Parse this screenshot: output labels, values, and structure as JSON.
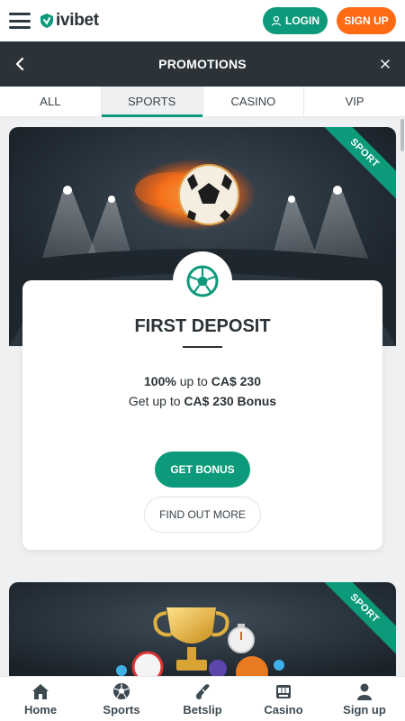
{
  "header": {
    "logo_text": "ivibet",
    "login_label": "LOGIN",
    "signup_label": "SIGN UP"
  },
  "promotions": {
    "title": "PROMOTIONS"
  },
  "tabs": [
    {
      "label": "ALL",
      "active": false
    },
    {
      "label": "SPORTS",
      "active": true
    },
    {
      "label": "CASINO",
      "active": false
    },
    {
      "label": "VIP",
      "active": false
    }
  ],
  "promos": [
    {
      "ribbon": "SPORT",
      "title": "FIRST DEPOSIT",
      "line1_bold": "100%",
      "line1_mid": " up to ",
      "line1_amount": "CA$ 230",
      "line2_prefix": "Get up to ",
      "line2_bold": "CA$ 230 Bonus",
      "cta_primary": "GET BONUS",
      "cta_secondary": "FIND OUT MORE"
    },
    {
      "ribbon": "SPORT"
    }
  ],
  "bottom_nav": [
    {
      "label": "Home",
      "icon": "home-icon"
    },
    {
      "label": "Sports",
      "icon": "soccer-ball-icon"
    },
    {
      "label": "Betslip",
      "icon": "betslip-icon"
    },
    {
      "label": "Casino",
      "icon": "slot-machine-icon"
    },
    {
      "label": "Sign up",
      "icon": "user-icon"
    }
  ],
  "colors": {
    "brand_green": "#0c9a7a",
    "signup_orange": "#ff6a13",
    "dark_header": "#2b3338"
  }
}
